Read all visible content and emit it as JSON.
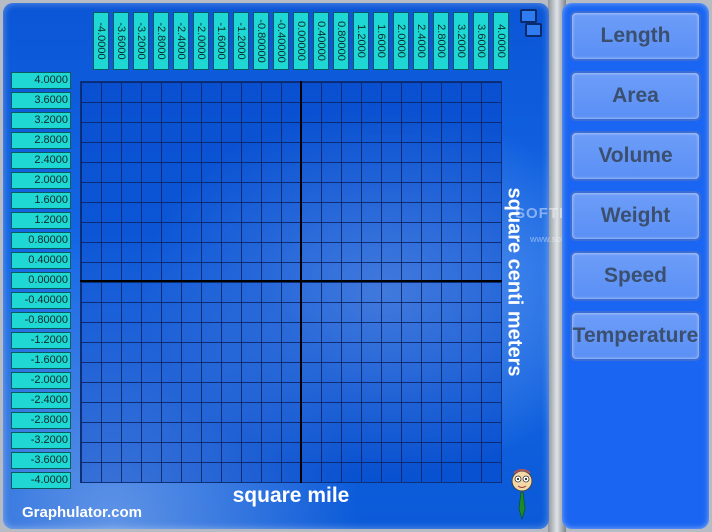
{
  "graph": {
    "x_ticks": [
      "-4.0000",
      "-3.6000",
      "-3.2000",
      "-2.8000",
      "-2.4000",
      "-2.0000",
      "-1.6000",
      "-1.2000",
      "-0.80000",
      "-0.40000",
      "0.00000",
      "0.40000",
      "0.80000",
      "1.2000",
      "1.6000",
      "2.0000",
      "2.4000",
      "2.8000",
      "3.2000",
      "3.6000",
      "4.0000"
    ],
    "y_ticks": [
      "4.0000",
      "3.6000",
      "3.2000",
      "2.8000",
      "2.4000",
      "2.0000",
      "1.6000",
      "1.2000",
      "0.80000",
      "0.40000",
      "0.00000",
      "-0.40000",
      "-0.80000",
      "-1.2000",
      "-1.6000",
      "-2.0000",
      "-2.4000",
      "-2.8000",
      "-3.2000",
      "-3.6000",
      "-4.0000"
    ],
    "x_axis_title": "square mile",
    "y_axis_title": "square centi meters"
  },
  "footer": {
    "site": "Graphulator.com"
  },
  "categories": [
    "Length",
    "Area",
    "Volume",
    "Weight",
    "Speed",
    "Temperature"
  ],
  "watermark": {
    "text": "SOFTPEDIA",
    "sub": "www.softpedia.com"
  },
  "colors": {
    "panel_blue": "#1467e6",
    "tick_label_bg": "#1fd8d3",
    "button_bg": "#6d9df8"
  },
  "icons": {
    "window_toggle": "window-toggle-icon",
    "mascot": "mascot-icon"
  }
}
